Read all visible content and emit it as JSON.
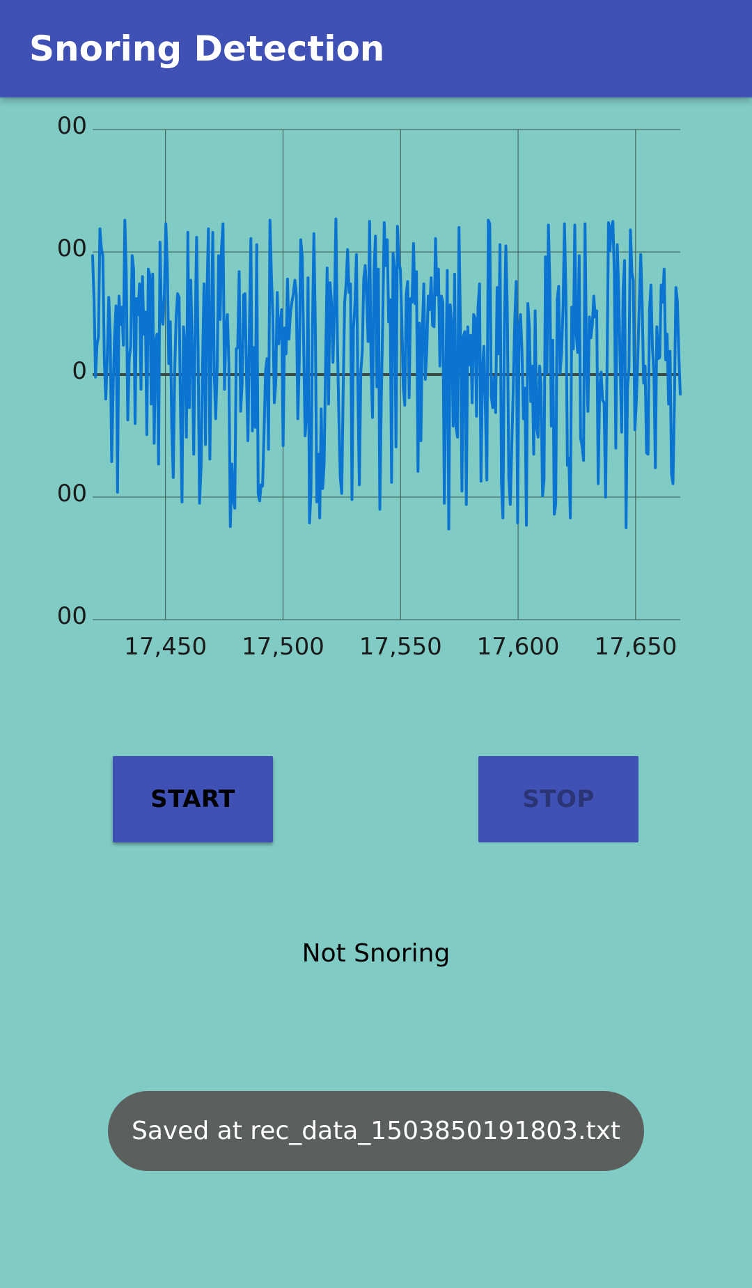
{
  "app": {
    "title": "Snoring Detection"
  },
  "chart_data": {
    "type": "line",
    "title": "",
    "xlabel": "",
    "ylabel": "",
    "x_tick_labels": [
      "17,450",
      "17,500",
      "17,550",
      "17,600",
      "17,650"
    ],
    "y_tick_labels": [
      "00",
      "00",
      "0",
      "00",
      "00"
    ],
    "xlim": [
      17419,
      17669
    ],
    "ylim": [
      -2,
      2
    ],
    "grid": true,
    "legend": "none",
    "line_color": "#0A74D0",
    "series": [
      {
        "values": [
          0.97,
          0.6,
          -0.02,
          0.24,
          0.31,
          1.19,
          1.03,
          0.97,
          0.13,
          -0.2,
          0.12,
          0.63,
          0.32,
          -0.71,
          -0.11,
          0.33,
          0.56,
          -0.96,
          0.64,
          0.41,
          0.55,
          0.24,
          1.26,
          0.81,
          -0.37,
          0.13,
          0.23,
          0.97,
          0.86,
          -0.4,
          0.62,
          0.49,
          0.74,
          -0.12,
          0.8,
          0.33,
          0.51,
          -0.49,
          0.86,
          0.81,
          -0.24,
          0.82,
          -0.56,
          0.27,
          0.33,
          -0.73,
          1.08,
          0.46,
          0.41,
          0.66,
          1.23,
          0.89,
          0.09,
          0.43,
          -0.43,
          -0.84,
          0.03,
          0.47,
          0.66,
          0.63,
          -0.32,
          -1.04,
          0.39,
          0.24,
          -0.51,
          1.16,
          -0.27,
          0.77,
          0.19,
          -0.65,
          0.38,
          1.12,
          0.2,
          -1.05,
          -0.75,
          0.07,
          0.74,
          -0.57,
          0.64,
          1.19,
          -0.69,
          0.32,
          1.16,
          0.01,
          -0.36,
          0.06,
          0.97,
          0.45,
          1.04,
          1.23,
          -0.12,
          0.38,
          0.49,
          0.08,
          -1.24,
          -0.73,
          -1.03,
          -1.09,
          0.21,
          0.22,
          0.84,
          -0.3,
          -0.08,
          0.65,
          0.66,
          -0.01,
          -0.54,
          0.38,
          1.11,
          -0.46,
          0.22,
          -0.43,
          1.06,
          -0.97,
          -1.03,
          -0.9,
          -0.91,
          -0.45,
          0.03,
          0.13,
          -0.61,
          1.26,
          0.81,
          0.47,
          -0.23,
          -0.06,
          0.67,
          0.25,
          0.41,
          0.53,
          -0.58,
          0.38,
          0.17,
          0.78,
          0.29,
          0.5,
          0.59,
          0.66,
          0.77,
          0.65,
          -0.36,
          0.1,
          1.1,
          0.97,
          0.25,
          -0.5,
          -0.33,
          0.79,
          -1.21,
          -0.96,
          0.36,
          1.15,
          0.39,
          -1.04,
          -0.65,
          -1.17,
          -0.28,
          -0.93,
          -0.73,
          0.11,
          0.87,
          -0.24,
          0.75,
          0.59,
          0.1,
          0.54,
          1.27,
          0.3,
          -0.33,
          -0.84,
          -0.97,
          -0.12,
          0.59,
          0.74,
          1.02,
          0.67,
          0.74,
          -1.02,
          0.38,
          0.56,
          0.98,
          -0.13,
          -0.9,
          0.02,
          0.19,
          0.78,
          0.89,
          0.62,
          0.27,
          1.25,
          0.09,
          -0.35,
          0.84,
          1.13,
          -0.1,
          0.86,
          -1.1,
          -0.2,
          0.45,
          1.24,
          0.89,
          1.1,
          0.43,
          0.61,
          -0.88,
          0.99,
          0.86,
          -0.59,
          1.21,
          0.91,
          0.86,
          0.44,
          -0.1,
          -0.25,
          0.65,
          0.76,
          -0.19,
          0.62,
          0.59,
          1.07,
          0.58,
          0.84,
          -0.79,
          0.42,
          -0.54,
          0.37,
          0.74,
          -0.04,
          0.19,
          0.64,
          0.53,
          0.79,
          0.4,
          0.39,
          1.11,
          0.65,
          0.86,
          0.07,
          0.64,
          0.59,
          -1.05,
          -0.12,
          0.85,
          -1.26,
          0.57,
          0.39,
          -0.42,
          0.82,
          -0.43,
          -0.51,
          1.2,
          0.38,
          -0.95,
          0.31,
          0.35,
          -1.06,
          0.39,
          0.08,
          0.32,
          -0.23,
          0.49,
          0.46,
          -0.34,
          0.55,
          0.74,
          -0.87,
          0.05,
          0.23,
          -0.28,
          -0.86,
          1.26,
          1.23,
          -0.17,
          -0.27,
          -0.02,
          -0.31,
          0.71,
          0.17,
          1.06,
          -0.88,
          -1.17,
          0.39,
          1.05,
          0.52,
          -0.84,
          -1.06,
          -0.58,
          -0.12,
          0.42,
          0.76,
          -1.21,
          0.38,
          0.49,
          0.18,
          -0.36,
          -0.11,
          -1.23,
          0.58,
          0.4,
          -0.22,
          0.07,
          -0.65,
          0.52,
          -0.43,
          -0.51,
          0.07,
          -0.09,
          -0.99,
          -0.86,
          0.96,
          0.01,
          1.22,
          0.74,
          -0.42,
          0.28,
          -1.14,
          -1.06,
          0.61,
          0.72,
          0.01,
          0.18,
          0.54,
          1.23,
          0.64,
          -0.74,
          -0.68,
          -1.17,
          0.55,
          0.21,
          1.22,
          0.33,
          0.18,
          0.97,
          -0.52,
          -0.58,
          -0.7,
          1.23,
          0.14,
          -0.3,
          0.47,
          0.3,
          0.41,
          0.64,
          0.47,
          0.52,
          -0.89,
          -0.12,
          0.02,
          -0.21,
          -0.23,
          -1.0,
          0.04,
          1.24,
          1.01,
          1.21,
          1.25,
          0.83,
          -0.6,
          1.06,
          0.65,
          0.08,
          -0.47,
          0.69,
          0.93,
          -1.25,
          -0.1,
          0.05,
          1.18,
          0.83,
          0.77,
          -0.45,
          -0.22,
          0.15,
          0.56,
          0.98,
          0.57,
          -0.07,
          0.07,
          -0.64,
          -0.65,
          0.53,
          0.73,
          0.22,
          0.02,
          -0.76,
          0.39,
          0.13,
          0.14,
          0.73,
          0.59,
          0.86,
          0.12,
          0.33,
          -0.24,
          0.19,
          -0.81,
          -0.89,
          -0.21,
          0.71,
          0.6,
          0.16,
          -0.16
        ]
      }
    ]
  },
  "controls": {
    "start_label": "START",
    "stop_label": "STOP"
  },
  "status": {
    "text": "Not Snoring"
  },
  "toast": {
    "text": "Saved at rec_data_1503850191803.txt"
  }
}
